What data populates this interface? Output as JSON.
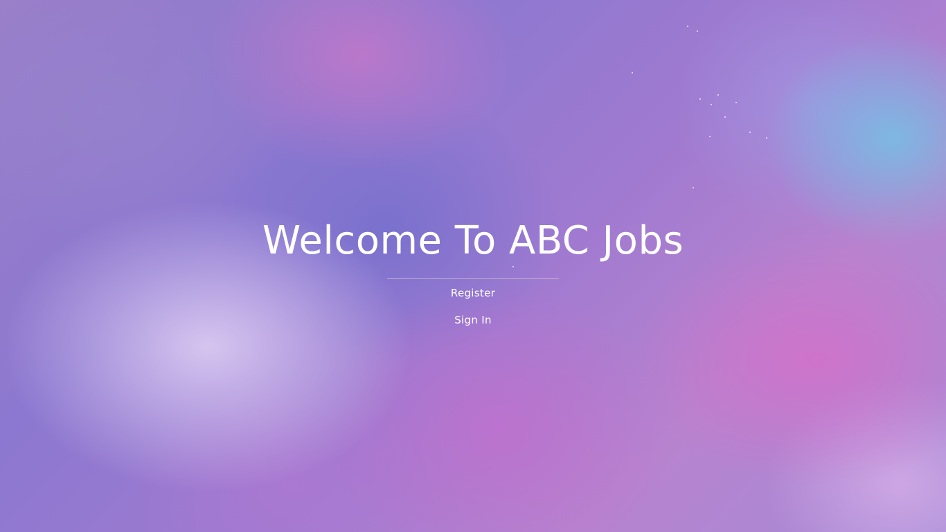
{
  "page": {
    "title": "Welcome To ABC Jobs"
  },
  "nav": {
    "register_label": "Register",
    "signin_label": "Sign In"
  },
  "theme": {
    "text_color": "#ffffff",
    "background": "purple-pink watercolor texture"
  }
}
